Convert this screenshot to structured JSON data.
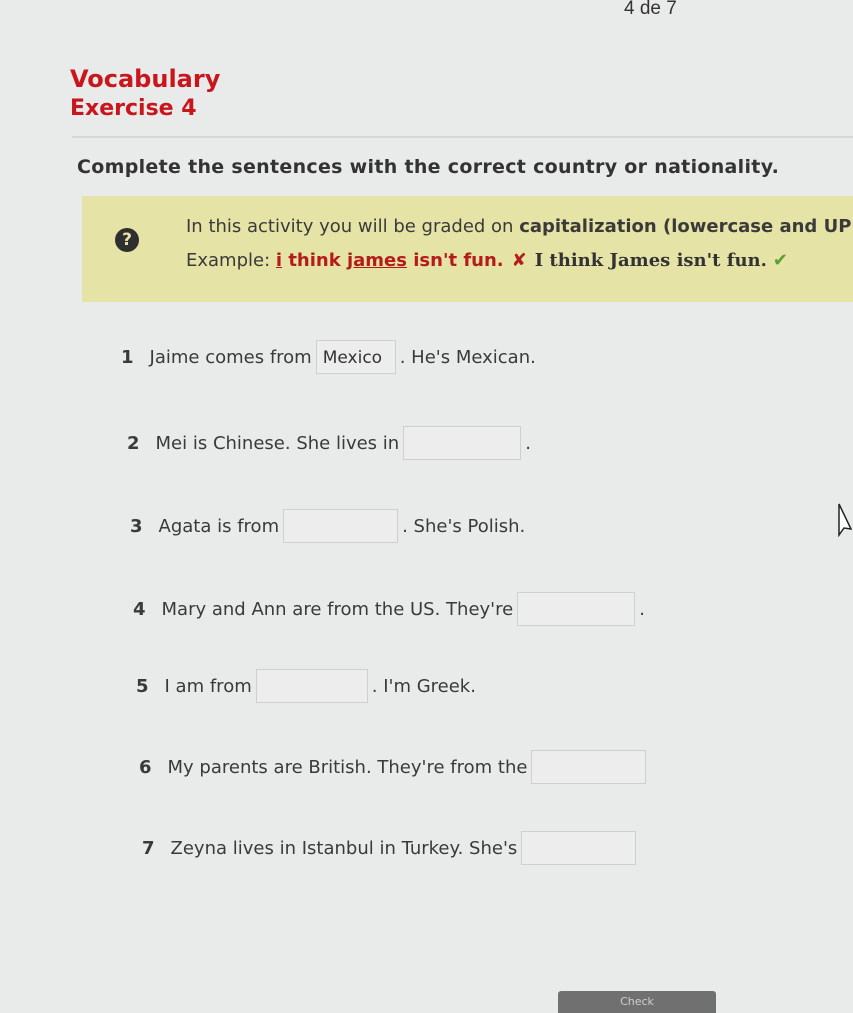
{
  "header": {
    "page_counter": "4 de 7",
    "title": "Vocabulary",
    "subtitle": "Exercise 4"
  },
  "instructions": "Complete the sentences with the correct country or nationality.",
  "info": {
    "icon": "question-circle-icon",
    "line1_start": "In this activity you will be graded on ",
    "line1_bold": "capitalization (lowercase and UPPER",
    "example_label": "Example: ",
    "wrong_i": "i",
    "wrong_think": " think ",
    "wrong_james": "james",
    "wrong_rest": " isn't fun.",
    "wrong_mark": "✘",
    "right_example": "I think James isn't fun.",
    "check_mark": "✔"
  },
  "questions": [
    {
      "number": "1",
      "before": "Jaime comes from",
      "answer": "Mexico",
      "after": ". He's Mexican."
    },
    {
      "number": "2",
      "before": "Mei is Chinese. She lives in",
      "answer": "",
      "after": "."
    },
    {
      "number": "3",
      "before": "Agata is from",
      "answer": "",
      "after": ". She's Polish."
    },
    {
      "number": "4",
      "before": "Mary and Ann are from the US. They're",
      "answer": "",
      "after": "."
    },
    {
      "number": "5",
      "before": "I am from",
      "answer": "",
      "after": ". I'm Greek."
    },
    {
      "number": "6",
      "before": "My parents are British. They're from the",
      "answer": "",
      "after": ""
    },
    {
      "number": "7",
      "before": "Zeyna lives in Istanbul in Turkey. She's",
      "answer": "",
      "after": ""
    }
  ],
  "footer": {
    "check_label": "Check"
  },
  "colors": {
    "accent_red": "#c9161d",
    "info_bg": "#e6e3a6",
    "check_green": "#5aa02c"
  }
}
